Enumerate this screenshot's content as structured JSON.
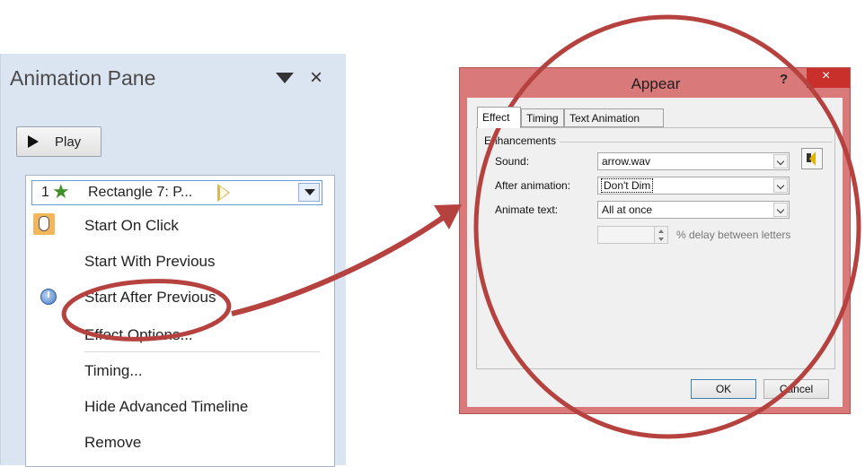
{
  "animation_pane": {
    "title": "Animation Pane",
    "play_label": "Play",
    "item": {
      "number": "1",
      "label": "Rectangle 7: P..."
    },
    "menu_items": [
      {
        "label": "Start On Click",
        "icon": "mouse-click-icon"
      },
      {
        "label": "Start With Previous",
        "icon": ""
      },
      {
        "label": "Start After Previous",
        "icon": "clock-icon"
      },
      {
        "label": "Effect Options...",
        "icon": ""
      },
      {
        "label": "Timing...",
        "icon": ""
      },
      {
        "label": "Hide Advanced Timeline",
        "icon": ""
      },
      {
        "label": "Remove",
        "icon": ""
      }
    ]
  },
  "dialog": {
    "title": "Appear",
    "help": "?",
    "close": "×",
    "tabs": [
      "Effect",
      "Timing",
      "Text Animation"
    ],
    "section": "Enhancements",
    "fields": {
      "sound_label": "Sound:",
      "sound_value": "arrow.wav",
      "after_label": "After animation:",
      "after_value": "Don't Dim",
      "animate_label": "Animate text:",
      "animate_value": "All at once",
      "delay_label": "% delay between letters",
      "delay_value": ""
    },
    "ok_label": "OK",
    "cancel_label": "Cancel"
  },
  "colors": {
    "annotation": "#b5423f",
    "dialog_border": "#d9797a",
    "close_button": "#c9302c",
    "pane_background": "#dbe4f1"
  }
}
